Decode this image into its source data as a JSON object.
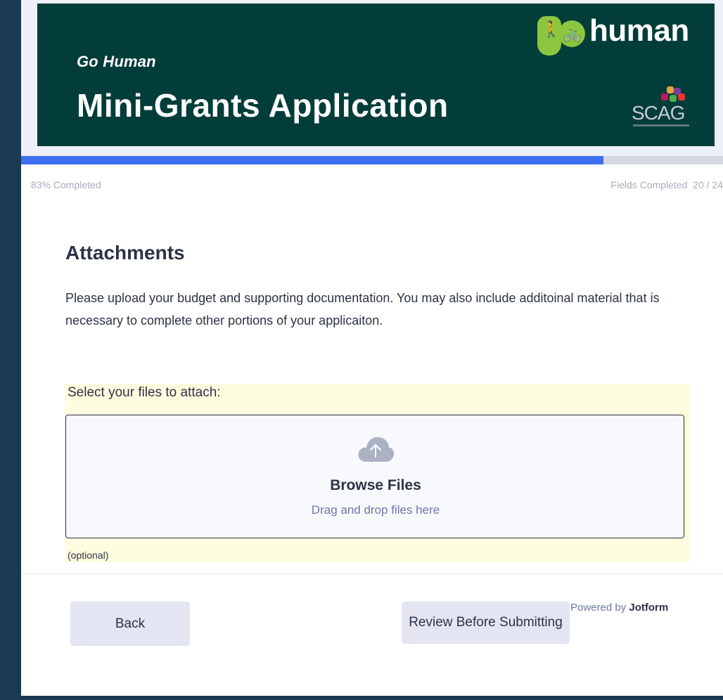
{
  "header": {
    "subtitle": "Go Human",
    "title": "Mini-Grants Application",
    "logo_text": "human",
    "partner_logo_text": "SCAG"
  },
  "progress": {
    "percent": 83,
    "percent_label": "83% Completed",
    "fields_label": "Fields Completed",
    "fields_value": "20 / 24"
  },
  "section": {
    "title": "Attachments",
    "description": "Please upload your budget and supporting documentation. You may also include additoinal material that is necessary to complete other portions of your applicaiton."
  },
  "upload": {
    "label": "Select your files to attach:",
    "browse_label": "Browse Files",
    "drag_label": "Drag and drop files here",
    "optional_label": "(optional)"
  },
  "footer": {
    "back_label": "Back",
    "review_label": "Review Before Submitting",
    "powered_prefix": "Powered by",
    "powered_brand": "Jotform"
  },
  "colors": {
    "banner_bg": "#033d3a",
    "progress_fill": "#3e6ff0",
    "logo_green": "#8cc63f",
    "upload_highlight": "#fffde0"
  },
  "icons": {
    "logo_walker": "walking-person-icon",
    "logo_bike": "bicycle-icon",
    "upload": "cloud-upload-icon"
  }
}
